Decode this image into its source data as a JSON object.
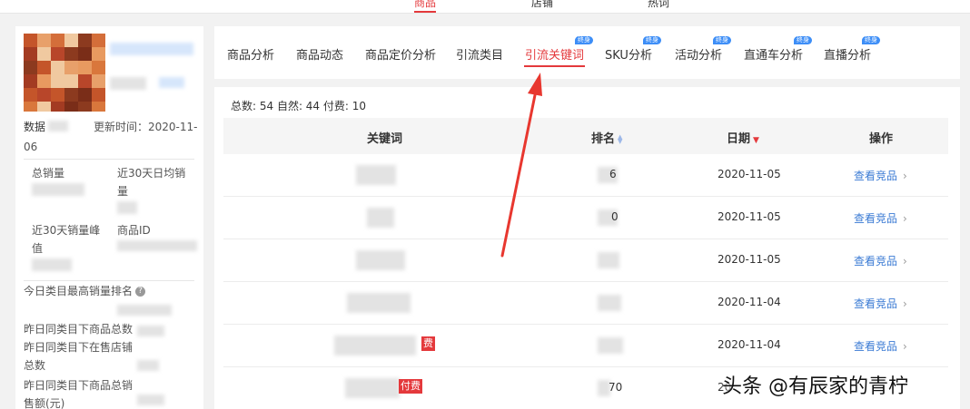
{
  "top_nav": {
    "items": [
      "商品",
      "店铺",
      "热词"
    ]
  },
  "left_panel": {
    "data_prefix": "数据",
    "update_label": "更新时间：2020-11-",
    "update_suffix": "06",
    "total_sales_label": "总销量",
    "avg_sales_label": "近30天日均销",
    "avg_sales_label2": "量",
    "peak_label": "近30天销量峰",
    "peak_label2": "值",
    "product_id_label": "商品ID",
    "rank_label": "今日类目最高销量排名",
    "yesterday_count_label": "昨日同类目下商品总数",
    "yesterday_shops_label": "昨日同类目下在售店铺",
    "yesterday_shops_label2": "总数",
    "yesterday_sales_label": "昨日同类目下商品总销",
    "yesterday_sales_label2": "售额(元)"
  },
  "tabs": [
    {
      "label": "商品分析",
      "badge": ""
    },
    {
      "label": "商品动态",
      "badge": ""
    },
    {
      "label": "商品定价分析",
      "badge": ""
    },
    {
      "label": "引流类目",
      "badge": ""
    },
    {
      "label": "引流关键词",
      "badge": "终身",
      "active": true
    },
    {
      "label": "SKU分析",
      "badge": "终身"
    },
    {
      "label": "活动分析",
      "badge": "终身"
    },
    {
      "label": "直通车分析",
      "badge": "终身"
    },
    {
      "label": "直播分析",
      "badge": "终身"
    }
  ],
  "summary": "总数: 54 自然: 44 付费: 10",
  "table": {
    "headers": {
      "keyword": "关键词",
      "rank": "排名",
      "date": "日期",
      "action": "操作"
    },
    "rows": [
      {
        "keyword_visible": "",
        "rank_visible": "6",
        "date": "2020-11-05",
        "action": "查看竞品",
        "tag": ""
      },
      {
        "keyword_visible": "",
        "rank_visible": "0",
        "date": "2020-11-05",
        "action": "查看竞品",
        "tag": ""
      },
      {
        "keyword_visible": "",
        "rank_visible": "",
        "date": "2020-11-05",
        "action": "查看竞品",
        "tag": ""
      },
      {
        "keyword_visible": "",
        "rank_visible": "",
        "date": "2020-11-04",
        "action": "查看竞品",
        "tag": ""
      },
      {
        "keyword_visible": "",
        "rank_visible": "",
        "date": "2020-11-04",
        "action": "查看竞品",
        "tag": "费"
      },
      {
        "keyword_visible": "",
        "rank_visible": "70",
        "date": "20",
        "action": "",
        "tag": "付费"
      }
    ]
  },
  "watermark": "头条 @有辰家的青柠",
  "colors": {
    "accent": "#e4393c",
    "link": "#3b7bd4",
    "badge": "#3d8ef7"
  }
}
